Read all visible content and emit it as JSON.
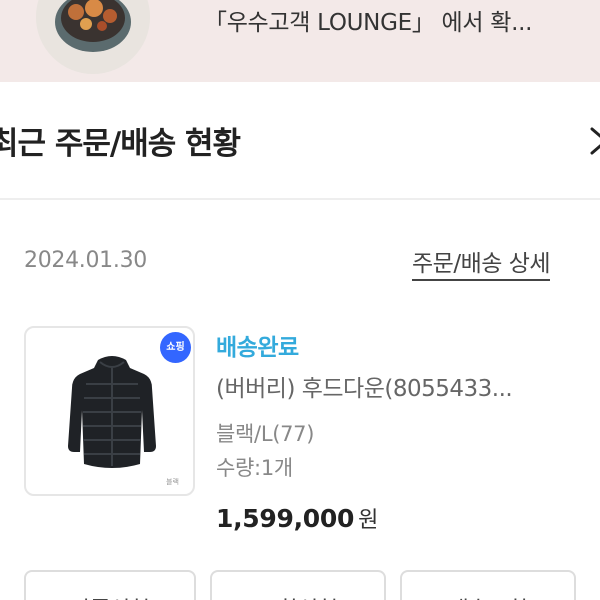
{
  "banner": {
    "text": "「우수고객 LOUNGE」 에서 확..."
  },
  "section": {
    "title": "최근 주문/배송 현황"
  },
  "order": {
    "date": "2024.01.30",
    "detail_link": "주문/배송 상세",
    "status": "배송완료",
    "product_name": "(버버리) 후드다운(8055433...",
    "option": "블랙/L(77)",
    "quantity": "수량:1개",
    "price": "1,599,000",
    "price_unit": "원",
    "badge_text": "쇼핑",
    "thumb_tag": "블랙"
  },
  "buttons": [
    {
      "label": "반품신청"
    },
    {
      "label": "교환신청"
    },
    {
      "label": "배송조회"
    }
  ],
  "colors": {
    "banner_bg": "#f3e9e8",
    "status": "#33aadc",
    "badge": "#3366ff"
  }
}
